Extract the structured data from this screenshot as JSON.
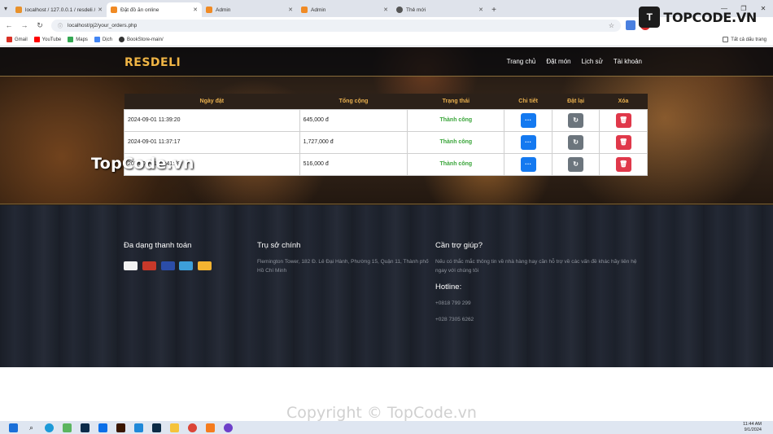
{
  "browser": {
    "tabs": [
      {
        "title": "localhost / 127.0.0.1 / resdeli / ...",
        "color": "#e8912b",
        "active": false
      },
      {
        "title": "Đặt đồ ăn online",
        "color": "#f08a24",
        "active": true
      },
      {
        "title": "Admin",
        "color": "#f08a24",
        "active": false
      },
      {
        "title": "Admin",
        "color": "#f08a24",
        "active": false
      },
      {
        "title": "Thẻ mới",
        "color": "#555555",
        "active": false
      }
    ],
    "url": "localhost/pj2/your_orders.php",
    "bookmarks": [
      "Gmail",
      "YouTube",
      "Maps",
      "Dịch",
      "BookStore-main/"
    ],
    "all_bookmarks": "Tất cả dấu trang"
  },
  "site": {
    "logo": "RESDELI",
    "menu": [
      "Trang chủ",
      "Đặt món",
      "Lịch sử",
      "Tài khoản"
    ]
  },
  "orders": {
    "headers": [
      "Ngày đặt",
      "Tổng cộng",
      "Trạng thái",
      "Chi tiết",
      "Đặt lại",
      "Xóa"
    ],
    "rows": [
      {
        "date": "2024-09-01 11:39:20",
        "total": "645,000 đ",
        "status": "Thành công"
      },
      {
        "date": "2024-09-01 11:37:17",
        "total": "1,727,000 đ",
        "status": "Thành công"
      },
      {
        "date": "2024-09-01 08:41:59",
        "total": "516,000 đ",
        "status": "Thành công"
      }
    ],
    "colors": {
      "detail": "#1479f0",
      "reorder": "#6c757d",
      "delete": "#e0384a",
      "status": "#3aa53a"
    }
  },
  "footer": {
    "payment_title": "Đa dạng thanh toán",
    "payment_methods": [
      "PayPal",
      "Mastercard",
      "Maestro",
      "Amex",
      "Bitcoin"
    ],
    "hq_title": "Trụ sở chính",
    "hq_address": "Flemington Tower, 182 Đ. Lê Đại Hành, Phường 15, Quận 11, Thành phố Hồ Chí Minh",
    "help_title": "Cần trợ giúp?",
    "help_text": "Nếu có thắc mắc thông tin về nhà hàng hay cần hỗ trợ về các vấn đề khác hãy liên hệ ngay với chúng tôi",
    "hotline_title": "Hotline:",
    "hotlines": [
      "+0818 799 299",
      "+028 7305 6262"
    ]
  },
  "watermarks": {
    "topcode_footer": "TopCode.vn",
    "copyright": "Copyright © TopCode.vn",
    "brand": "TOPCODE.VN"
  },
  "taskbar": {
    "time": "11:44 AM",
    "date": "9/1/2024"
  }
}
